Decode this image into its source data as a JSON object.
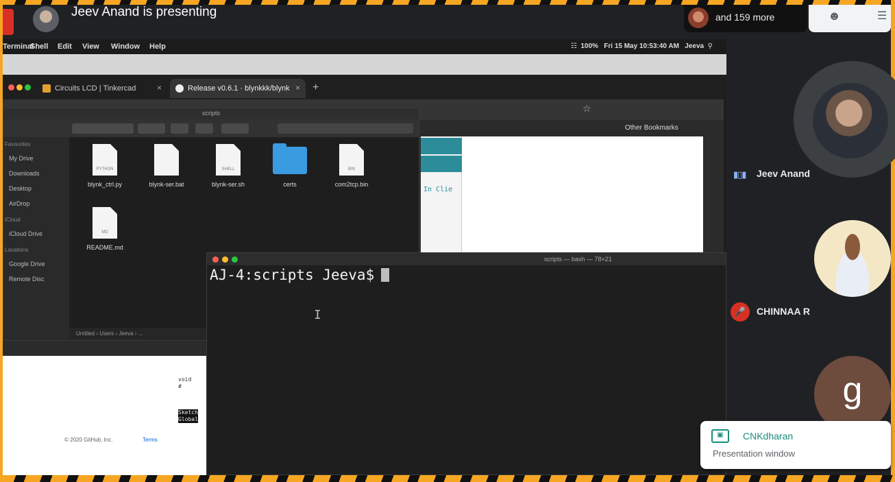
{
  "meet": {
    "presenting_text": "Jeev Anand is presenting",
    "participants_more": "and 159 more"
  },
  "mac_menubar": {
    "items": [
      "Terminal",
      "Shell",
      "Edit",
      "View",
      "Window",
      "Help"
    ],
    "battery": "100%",
    "datetime": "Fri 15 May 10:53:40 AM",
    "user": "Jeeva"
  },
  "chrome": {
    "tabs": [
      {
        "label": "Circuits LCD | Tinkercad"
      },
      {
        "label": "Release v0.6.1 · blynkkk/blynk"
      }
    ],
    "bookmarks_label": "Other Bookmarks",
    "page_code_snippet": "In Clie"
  },
  "finder": {
    "title": "scripts",
    "sidebar": [
      {
        "label": "Favourites",
        "header": true
      },
      {
        "label": "My Drive"
      },
      {
        "label": "Downloads"
      },
      {
        "label": "Desktop"
      },
      {
        "label": "AirDrop"
      },
      {
        "label": "iCloud",
        "header": true
      },
      {
        "label": "iCloud Drive"
      },
      {
        "label": "Locations",
        "header": true
      },
      {
        "label": "Google Drive"
      },
      {
        "label": "Remote Disc"
      }
    ],
    "files": [
      {
        "name": "blynk_ctrl.py",
        "kind": "doc",
        "ext": "PYTHON"
      },
      {
        "name": "blynk-ser.bat",
        "kind": "doc",
        "ext": ""
      },
      {
        "name": "blynk-ser.sh",
        "kind": "doc",
        "ext": "SHELL"
      },
      {
        "name": "certs",
        "kind": "folder",
        "ext": ""
      },
      {
        "name": "com2tcp.bin",
        "kind": "doc",
        "ext": "BIN"
      },
      {
        "name": "README.md",
        "kind": "doc",
        "ext": "MD"
      }
    ],
    "path_bar": "Untitled › Users › Jeeva › ..."
  },
  "github_page": {
    "footer_copyright": "© 2020 GitHub, Inc.",
    "footer_terms": "Terms",
    "code_lines": [
      "void",
      "#",
      "Sketch",
      "Global"
    ]
  },
  "terminal": {
    "title": "scripts — bash — 78×21",
    "prompt": "AJ-4:scripts Jeeva$"
  },
  "participants": [
    {
      "name": "Jeev Anand",
      "status": "speaking"
    },
    {
      "name": "CHINNAA R",
      "status": "muted"
    },
    {
      "name": "",
      "initial": "g"
    }
  ],
  "toast": {
    "name": "CNKdharan",
    "subtitle": "Presentation window"
  },
  "colors": {
    "accent_orange": "#f6a623",
    "meet_red": "#d93025",
    "teal": "#1a8c7c"
  }
}
